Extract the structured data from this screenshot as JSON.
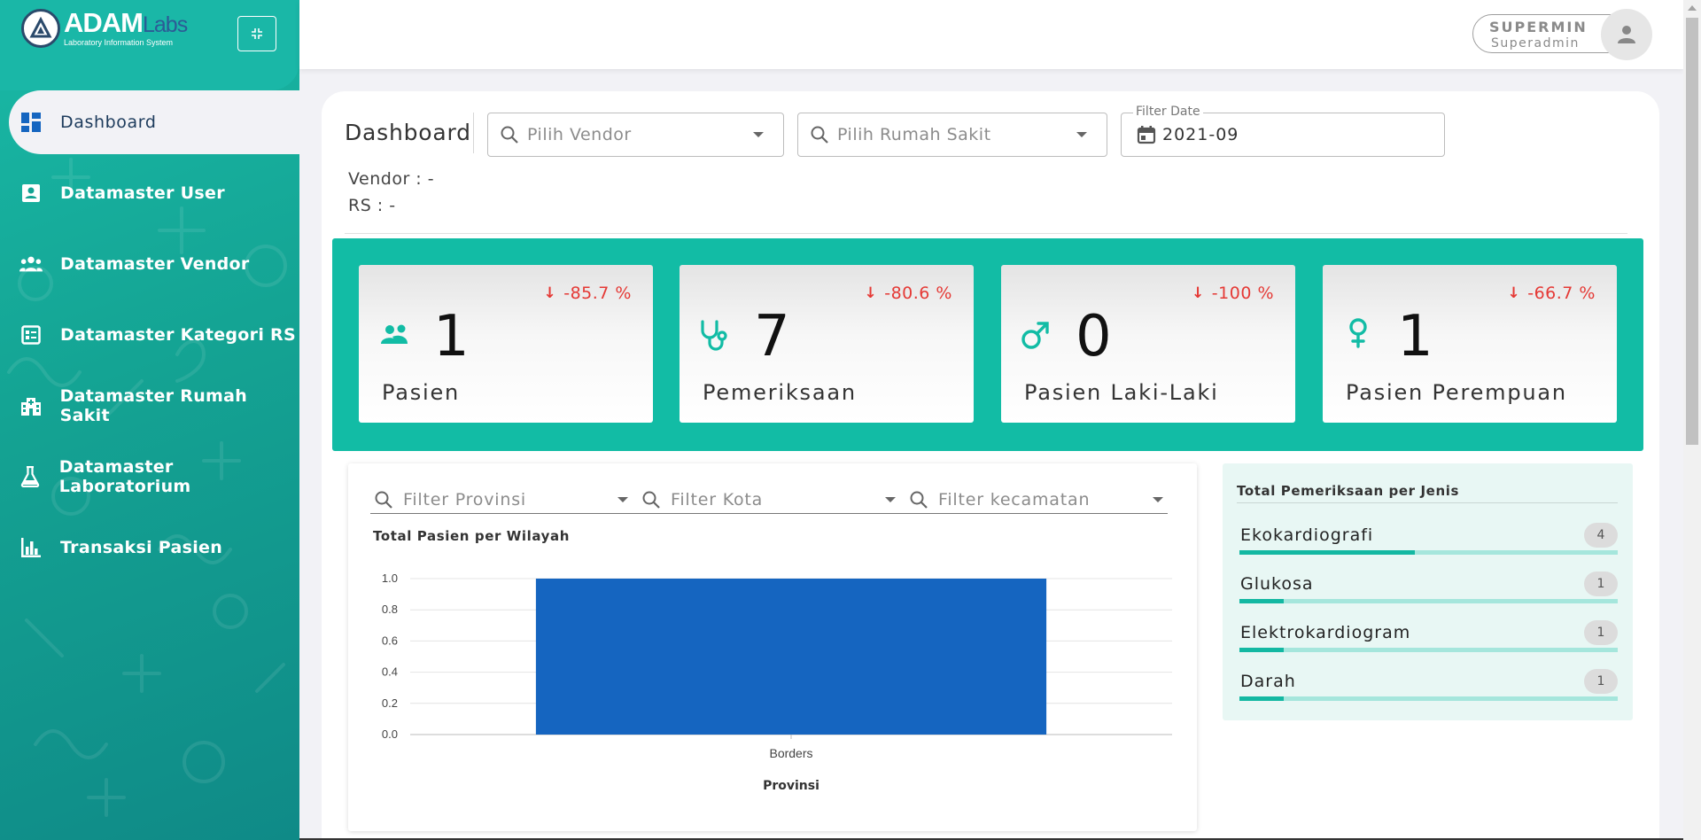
{
  "app": {
    "logo_name": "ADAM",
    "logo_labs": "Labs",
    "logo_sub": "Laboratory Information System"
  },
  "sidebar": {
    "items": [
      {
        "label": "Dashboard",
        "icon": "dashboard-icon",
        "active": true
      },
      {
        "label": "Datamaster User",
        "icon": "user-card-icon"
      },
      {
        "label": "Datamaster Vendor",
        "icon": "group-icon"
      },
      {
        "label": "Datamaster Kategori RS",
        "icon": "list-card-icon"
      },
      {
        "label": "Datamaster Rumah Sakit",
        "icon": "hospital-icon"
      },
      {
        "label": "Datamaster Laboratorium",
        "icon": "flask-icon"
      },
      {
        "label": "Transaksi Pasien",
        "icon": "bar-chart-icon"
      }
    ]
  },
  "user": {
    "name": "SUPERMIN",
    "role": "Superadmin"
  },
  "page": {
    "title": "Dashboard",
    "vendor_placeholder": "Pilih Vendor",
    "rs_placeholder": "Pilih Rumah Sakit",
    "date_label": "Filter Date",
    "date_value": "2021-09",
    "vendor_info": "Vendor : -",
    "rs_info": "RS : -"
  },
  "stats": [
    {
      "value": "1",
      "label": "Pasien",
      "change": "-85.7 %",
      "icon": "people-icon"
    },
    {
      "value": "7",
      "label": "Pemeriksaan",
      "change": "-80.6 %",
      "icon": "stethoscope-icon"
    },
    {
      "value": "0",
      "label": "Pasien Laki-Laki",
      "change": "-100 %",
      "icon": "male-icon"
    },
    {
      "value": "1",
      "label": "Pasien Perempuan",
      "change": "-66.7 %",
      "icon": "female-icon"
    }
  ],
  "filters": {
    "provinsi": "Filter Provinsi",
    "kota": "Filter Kota",
    "kecamatan": "Filter kecamatan"
  },
  "chart_data": {
    "type": "bar",
    "title": "Total Pasien per Wilayah",
    "categories": [
      "Borders"
    ],
    "values": [
      1.0
    ],
    "xlabel": "Provinsi",
    "ylabel": "",
    "ylim": [
      0,
      1.0
    ],
    "yticks": [
      "0.0",
      "0.2",
      "0.4",
      "0.6",
      "0.8",
      "1.0"
    ],
    "grid": true,
    "bar_color": "#1565c0"
  },
  "pemeriksaan": {
    "title": "Total Pemeriksaan per Jenis",
    "items": [
      {
        "name": "Ekokardiografi",
        "count": "4",
        "fraction": 0.4638
      },
      {
        "name": "Glukosa",
        "count": "1",
        "fraction": 0.116
      },
      {
        "name": "Elektrokardiogram",
        "count": "1",
        "fraction": 0.116
      },
      {
        "name": "Darah",
        "count": "1",
        "fraction": 0.116
      }
    ]
  },
  "colors": {
    "teal": "#12bca5",
    "negative": "#e53935",
    "bar": "#1565c0"
  }
}
